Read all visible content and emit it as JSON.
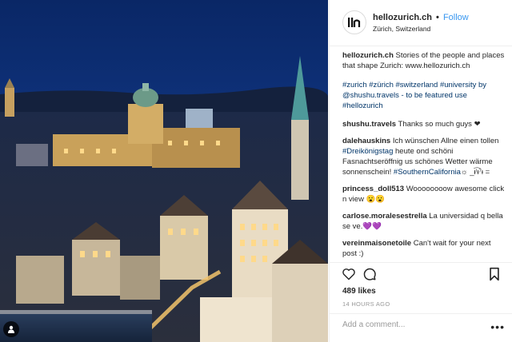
{
  "photo": {
    "alt": "",
    "tag_icon": "person-tag-icon"
  },
  "header": {
    "username": "hellozurich.ch",
    "separator": "•",
    "follow_label": "Follow",
    "location": "Zürich, Switzerland",
    "avatar_icon": "hellozurich-logo-icon"
  },
  "caption": {
    "username": "hellozurich.ch",
    "text": "Stories of the people and places that shape Zurich: www.hellozurich.ch",
    "hashtags": "#zurich #zürich #switzerland #university by @shushu.travels - to be featured use #hellozurich"
  },
  "comments": [
    {
      "username": "shushu.travels",
      "text": "Thanks so much guys ❤"
    },
    {
      "username": "dalehauskins",
      "text": "Ich wünschen Allne einen tollen ",
      "tag": "#Dreikönigstag",
      "text2": " heute ond schöni Fasnachtseröffnig us schönes Wetter wärme sonnenschein! ",
      "tag2": "#SouthernCalifornia",
      "text3": "☼ _ᵼⁱ͡ᵼ⁷ᵼ ="
    },
    {
      "username": "princess_doll513",
      "text": "Woooooooow awesome click n view 😮😮"
    },
    {
      "username": "carlose.moralesestrella",
      "text": "La universidad q bella se ve.💜💜"
    },
    {
      "username": "vereinmaisonetoile",
      "text": "Can't wait for your next post :)"
    }
  ],
  "actions": {
    "like_icon": "heart-icon",
    "comment_icon": "comment-icon",
    "save_icon": "bookmark-icon",
    "likes": "489 likes",
    "time": "14 HOURS AGO"
  },
  "add_comment": {
    "placeholder": "Add a comment...",
    "more_label": "•••"
  },
  "colors": {
    "link": "#3897f0",
    "hashtag": "#003569",
    "border": "#efefef",
    "sky": "#0c2a6b"
  }
}
